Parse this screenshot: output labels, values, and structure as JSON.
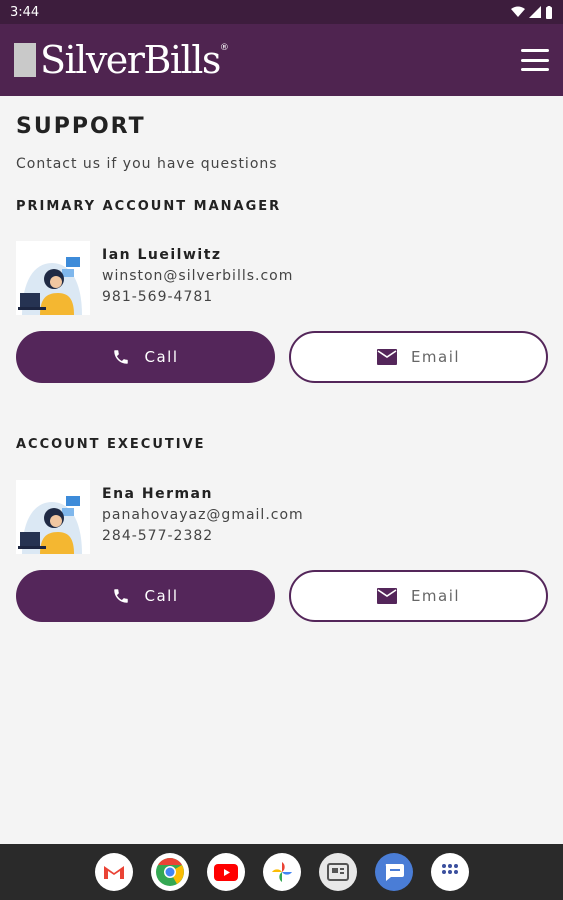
{
  "status": {
    "time": "3:44"
  },
  "app": {
    "logo_text": "SilverBills",
    "logo_mark": "®"
  },
  "page": {
    "title": "SUPPORT",
    "subtitle": "Contact us if you have questions"
  },
  "contacts": [
    {
      "section": "PRIMARY ACCOUNT MANAGER",
      "name": "Ian Lueilwitz",
      "email": "winston@silverbills.com",
      "phone": "981-569-4781",
      "call_label": "Call",
      "email_label": "Email"
    },
    {
      "section": "ACCOUNT EXECUTIVE",
      "name": "Ena Herman",
      "email": "panahovayaz@gmail.com",
      "phone": "284-577-2382",
      "call_label": "Call",
      "email_label": "Email"
    }
  ],
  "colors": {
    "brand": "#4f2450",
    "button": "#54265a",
    "statusbar": "#3d1d3d"
  },
  "dock": [
    "gmail-icon",
    "chrome-icon",
    "youtube-icon",
    "photos-icon",
    "news-icon",
    "messages-icon",
    "app-drawer-icon"
  ]
}
